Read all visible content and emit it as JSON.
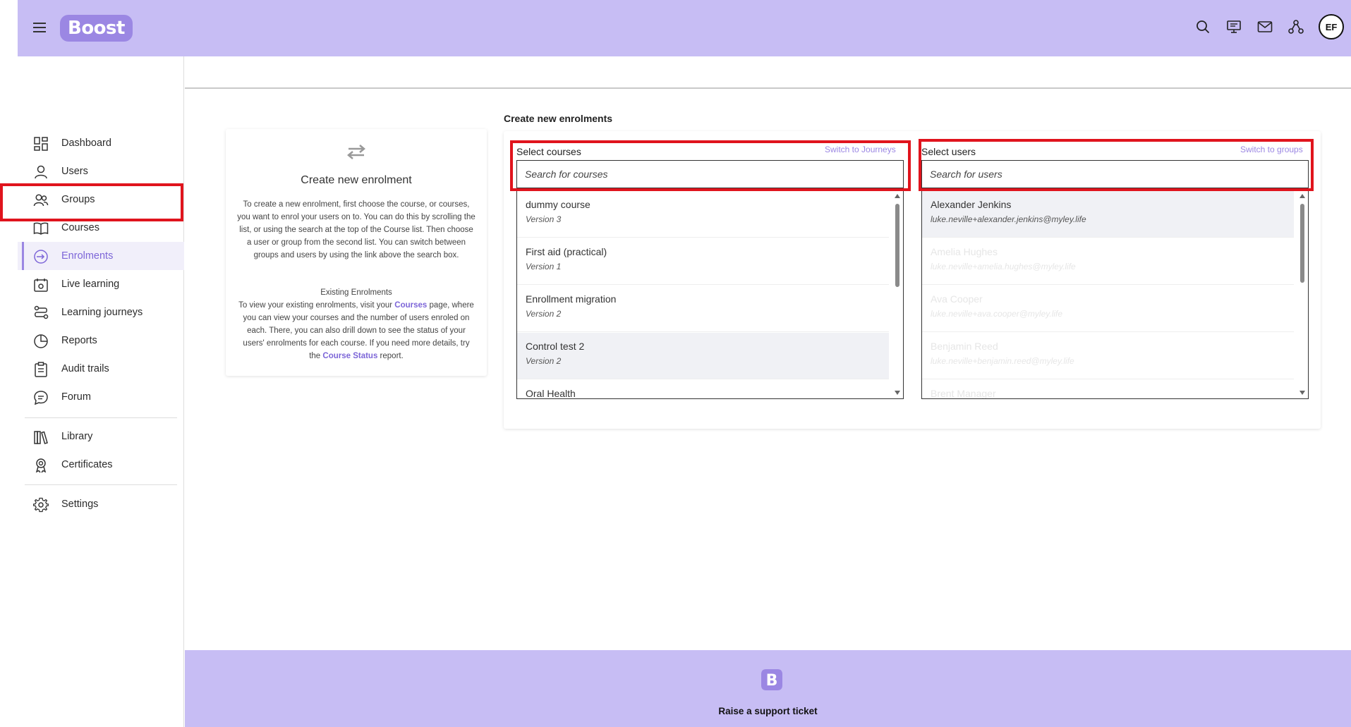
{
  "app": {
    "logo_text": "Boost",
    "avatar_initials": "EF"
  },
  "colors": {
    "header_bg": "#c7bdf4",
    "accent": "#9b87e3",
    "active_text": "#7d66d8",
    "highlight_border": "#e0141d"
  },
  "header": {
    "icons": [
      "search-icon",
      "presentation-icon",
      "mail-icon",
      "network-icon"
    ]
  },
  "sidebar": {
    "items": [
      {
        "label": "Dashboard",
        "icon": "dashboard-icon"
      },
      {
        "label": "Users",
        "icon": "user-icon"
      },
      {
        "label": "Groups",
        "icon": "group-icon"
      },
      {
        "label": "Courses",
        "icon": "book-icon"
      },
      {
        "label": "Enrolments",
        "icon": "enrol-icon",
        "active": true
      },
      {
        "label": "Live learning",
        "icon": "calendar-icon"
      },
      {
        "label": "Learning journeys",
        "icon": "journey-icon"
      },
      {
        "label": "Reports",
        "icon": "pie-chart-icon"
      },
      {
        "label": "Audit trails",
        "icon": "clipboard-icon"
      },
      {
        "label": "Forum",
        "icon": "chat-icon"
      },
      {
        "label": "Library",
        "icon": "library-icon"
      },
      {
        "label": "Certificates",
        "icon": "award-icon"
      },
      {
        "label": "Settings",
        "icon": "gear-icon"
      }
    ]
  },
  "info": {
    "title": "Create new enrolment",
    "body": "To create a new enrolment, first choose the course, or courses, you want to enrol your users on to. You can do this by scrolling the list, or using the search at the top of the Course list. Then choose a user or group from the second list. You can switch between groups and users by using the link above the search box.",
    "existing_title": "Existing Enrolments",
    "existing_1": "To view your existing enrolments, visit your ",
    "courses_link": "Courses",
    "existing_2": " page, where you can view your courses and the number of users enroled on each. There, you can also drill down to see the status of your users' enrolments for each course. If you need more details, try the ",
    "course_status_link": "Course Status",
    "existing_3": " report."
  },
  "enrol": {
    "section_title": "Create new enrolments",
    "courses": {
      "label": "Select courses",
      "switch_label": "Switch to Journeys",
      "placeholder": "Search for courses",
      "items": [
        {
          "title": "dummy course",
          "subtitle": "Version 3"
        },
        {
          "title": "First aid (practical)",
          "subtitle": "Version 1"
        },
        {
          "title": "Enrollment migration",
          "subtitle": "Version 2"
        },
        {
          "title": "Control test 2",
          "subtitle": "Version 2"
        },
        {
          "title": "Oral Health",
          "subtitle": ""
        }
      ]
    },
    "users": {
      "label": "Select users",
      "switch_label": "Switch to groups",
      "placeholder": "Search for users",
      "items": [
        {
          "title": "Alexander Jenkins",
          "subtitle": "luke.neville+alexander.jenkins@myley.life"
        },
        {
          "title": "Amelia Hughes",
          "subtitle": "luke.neville+amelia.hughes@myley.life"
        },
        {
          "title": "Ava Cooper",
          "subtitle": "luke.neville+ava.cooper@myley.life"
        },
        {
          "title": "Benjamin Reed",
          "subtitle": "luke.neville+benjamin.reed@myley.life"
        },
        {
          "title": "Brent Manager",
          "subtitle": ""
        }
      ]
    }
  },
  "footer": {
    "logo_letter": "B",
    "ticket_label": "Raise a support ticket"
  }
}
